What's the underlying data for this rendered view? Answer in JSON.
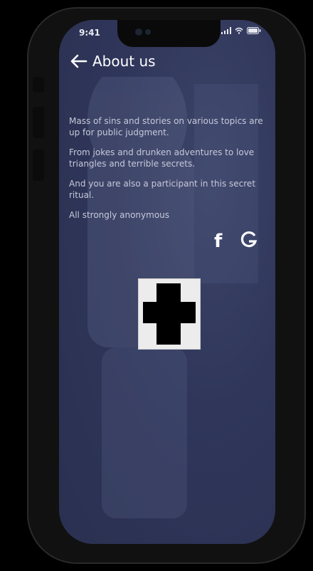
{
  "status": {
    "time": "9:41"
  },
  "header": {
    "back_icon": "arrow-left-icon",
    "title": "About us"
  },
  "about": {
    "paragraphs": [
      "Mass of sins and stories on various topics are up for public judgment.",
      "From jokes and drunken adventures to love triangles and terrible secrets.",
      "And you are also a participant in this secret ritual.",
      "All strongly anonymous"
    ]
  },
  "social": {
    "facebook_label": "f",
    "google_icon": "google-icon"
  },
  "artwork": {
    "name": "black-cross-image"
  },
  "colors": {
    "screen_bg": "#2f365a",
    "text": "#c6c9da",
    "title": "#ffffff"
  }
}
